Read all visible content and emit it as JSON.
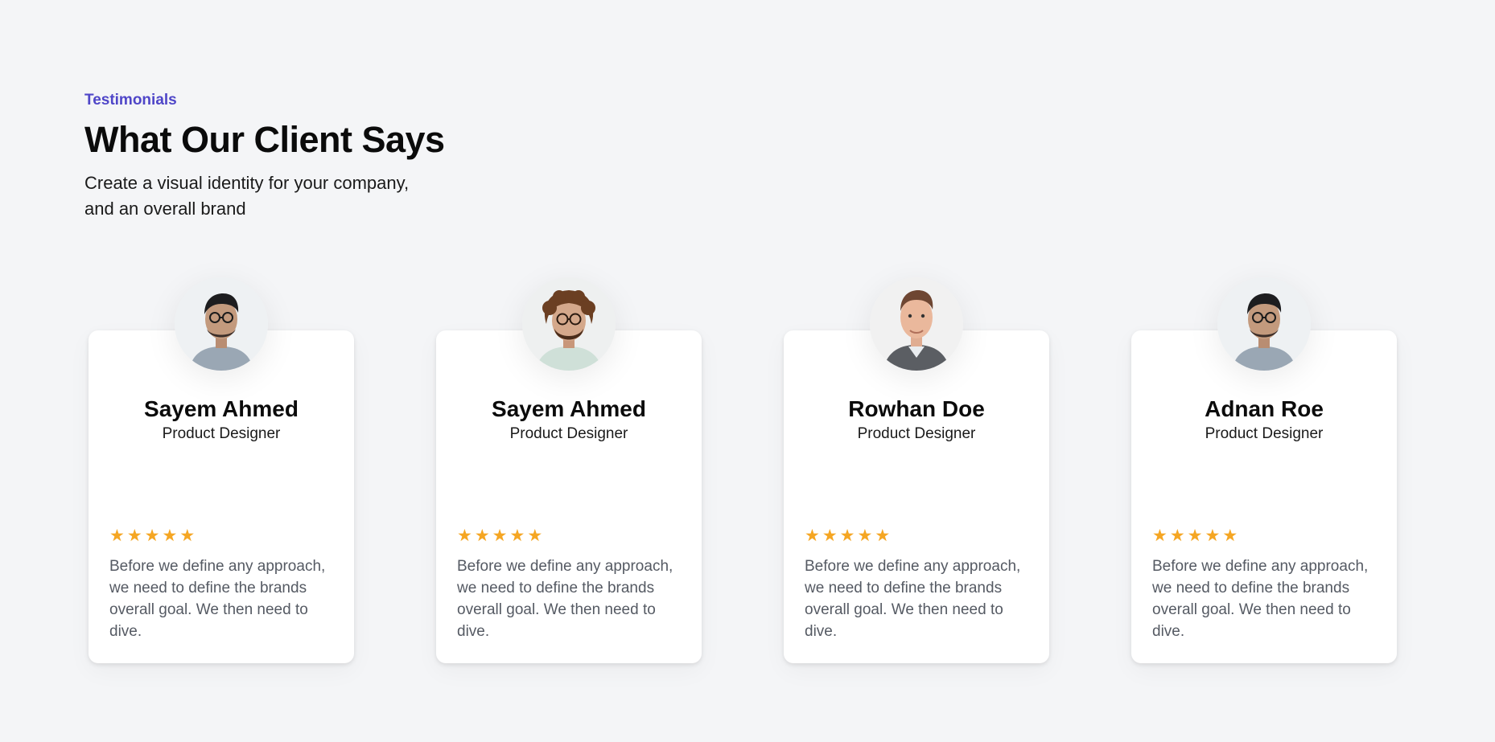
{
  "header": {
    "eyebrow": "Testimonials",
    "title": "What Our Client Says",
    "subtitle": "Create a visual identity for your company, and an overall brand"
  },
  "colors": {
    "accent": "#4f46c8",
    "star": "#f5a623",
    "background": "#f4f5f7"
  },
  "testimonials": [
    {
      "name": "Sayem Ahmed",
      "role": "Product Designer",
      "rating": 5,
      "stars": [
        "★",
        "★",
        "★",
        "★",
        "★"
      ],
      "quote": "Before we define any approach, we need to define the brands overall goal. We then need to dive.",
      "avatar": "avatar-photo"
    },
    {
      "name": "Sayem Ahmed",
      "role": "Product Designer",
      "rating": 5,
      "stars": [
        "★",
        "★",
        "★",
        "★",
        "★"
      ],
      "quote": "Before we define any approach, we need to define the brands overall goal. We then need to dive.",
      "avatar": "avatar-photo"
    },
    {
      "name": "Rowhan Doe",
      "role": "Product Designer",
      "rating": 5,
      "stars": [
        "★",
        "★",
        "★",
        "★",
        "★"
      ],
      "quote": "Before we define any approach, we need to define the brands overall goal. We then need to dive.",
      "avatar": "avatar-photo"
    },
    {
      "name": "Adnan Roe",
      "role": "Product Designer",
      "rating": 5,
      "stars": [
        "★",
        "★",
        "★",
        "★",
        "★"
      ],
      "quote": "Before we define any approach, we need to define the brands overall goal. We then need to dive.",
      "avatar": "avatar-photo"
    }
  ]
}
